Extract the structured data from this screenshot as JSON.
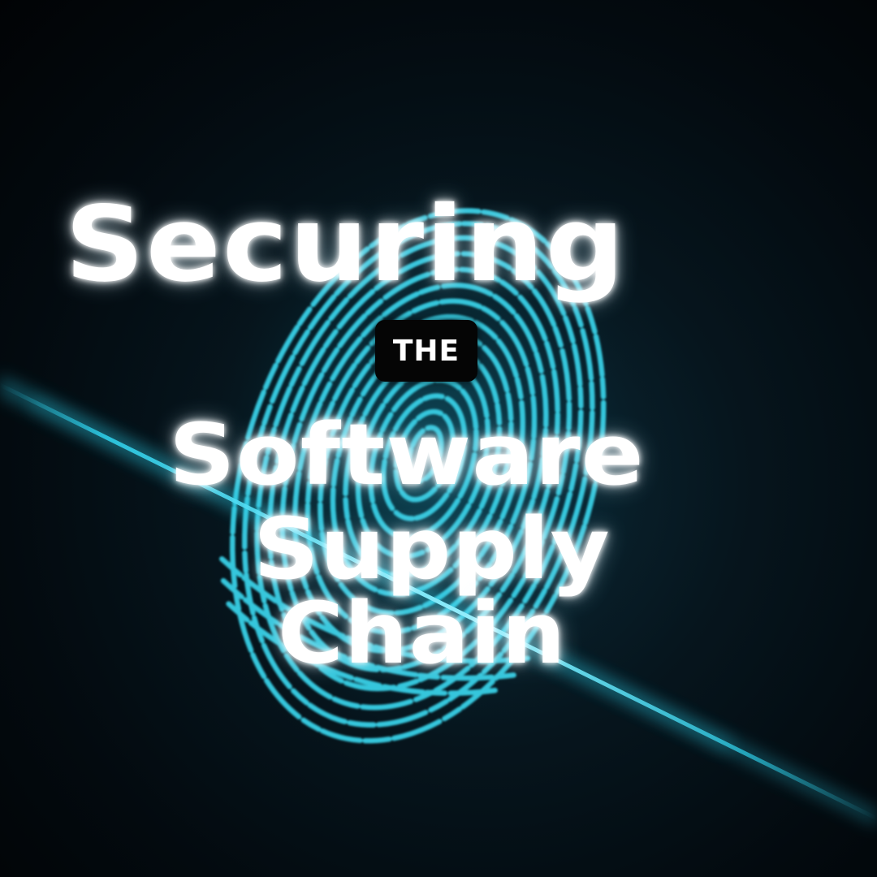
{
  "title": {
    "line1": "Securing",
    "badge": "THE",
    "line2": "Software",
    "line3": "Supply",
    "line4": "Chain"
  },
  "artwork": {
    "icon": "fingerprint-icon",
    "streak": "light-streak",
    "fingerprint_color": "#35c6dc",
    "streak_color": "#2fd3ee",
    "background_color": "#030b10"
  }
}
